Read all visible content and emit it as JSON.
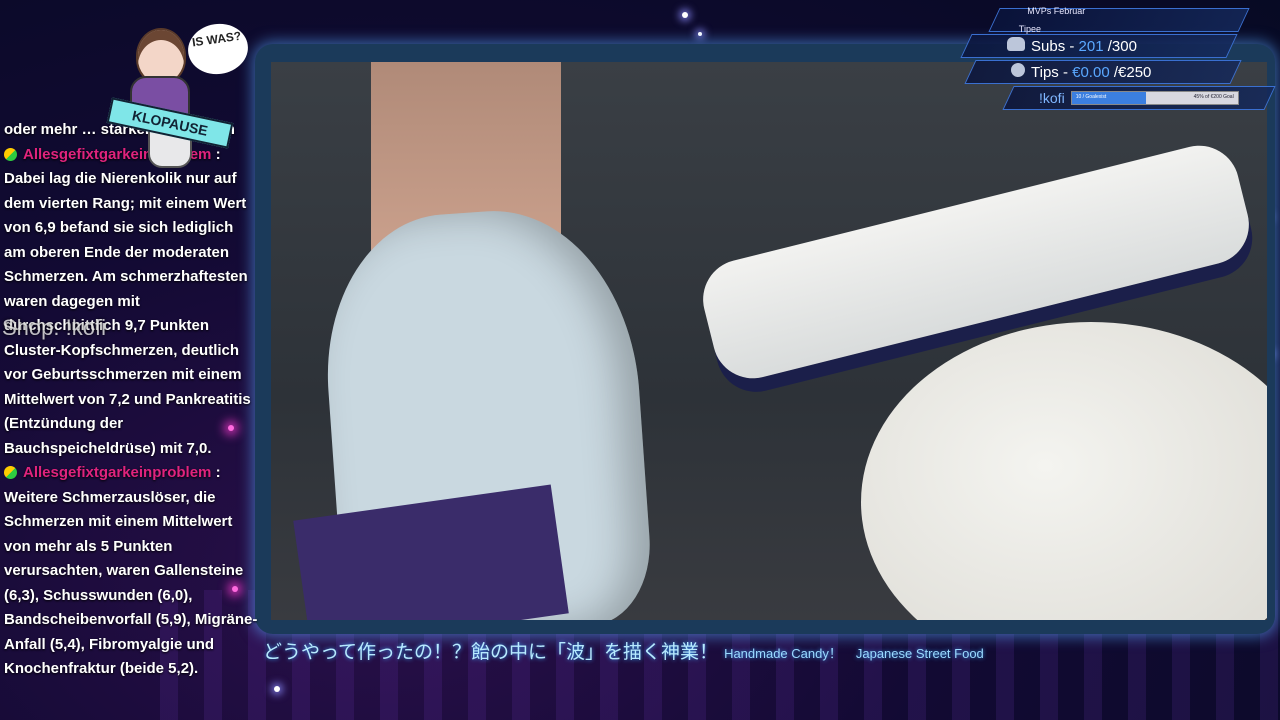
{
  "chat": {
    "partial_top": "oder mehr … starker Schmerzen",
    "messages": [
      {
        "user": "Allesgefixtgarkeinproblem",
        "text": "Dabei lag die Nierenkolik nur auf dem vierten Rang; mit einem Wert von 6,9 befand sie sich lediglich am oberen Ende der moderaten Schmerzen. Am schmerzhaftesten waren dagegen mit durchschnittlich 9,7 Punkten Cluster-Kopfschmerzen, deutlich vor Geburtsschmerzen mit einem Mittelwert von 7,2 und Pankreatitis (Entzündung der Bauchspeicheldrüse) mit 7,0."
      },
      {
        "user": "Allesgefixtgarkeinproblem",
        "text": "Weitere Schmerzauslöser, die Schmerzen mit einem Mittelwert von mehr als 5 Punkten verursachten, waren Gallensteine (6,3), Schusswunden (6,0), Bandscheibenvorfall (5,9), Migräne-Anfall (5,4), Fibromyalgie und Knochenfraktur (beide 5,2)."
      }
    ],
    "colon": ":",
    "overlay_shop": "Shop: !kofi"
  },
  "sticker": {
    "bubble": "IS WAS?",
    "banner": "KLOPAUSE"
  },
  "goals": {
    "mvp_title": "MVPs Februar",
    "mvp_name": "Tipee",
    "subs_label": "Subs - ",
    "subs_current": "201",
    "subs_target": "/300",
    "tips_label": "Tips - ",
    "tips_current": "€0.00",
    "tips_target": "/€250",
    "kofi_label": "!kofi",
    "kofi_progress_left": "10 / Goalexist",
    "kofi_progress_right": "45% of €200 Goal",
    "kofi_progress": 0.45
  },
  "subtitle": {
    "jp": "どうやって作ったの！？飴の中に「波」を描く神業！",
    "en1": "Handmade Candy！",
    "en2": "Japanese Street Food"
  },
  "colors": {
    "username": "#e0237d",
    "accent": "#5aa8ff",
    "frame_glow": "#5aaaff"
  }
}
